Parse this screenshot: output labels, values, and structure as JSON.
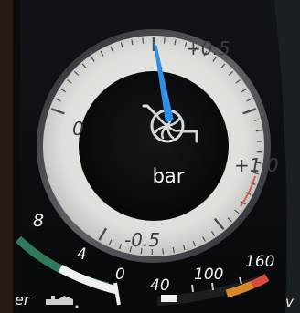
{
  "boost_gauge": {
    "unit": "bar",
    "labels": {
      "top": "+0.5",
      "left": "0",
      "right": "+1.0",
      "bottom": "-0.5"
    },
    "icon": "turbo-icon",
    "needle_value": 0.45
  },
  "oil_gauge": {
    "labels": [
      "8",
      "4",
      "0"
    ],
    "icon": "oil-can-icon"
  },
  "temp_gauge": {
    "labels": [
      "40",
      "100",
      "160"
    ]
  },
  "partial_left_text": "er",
  "partial_right_text": "v",
  "colors": {
    "dial_face": "#dcdcd7",
    "dial_center": "#090a0c",
    "needle": "#2f8fe6",
    "bezel": "#5a5e62",
    "red_zone": "#d84a3a",
    "oil_band": "#2f7a5a",
    "temp_band": "#d8862a"
  }
}
